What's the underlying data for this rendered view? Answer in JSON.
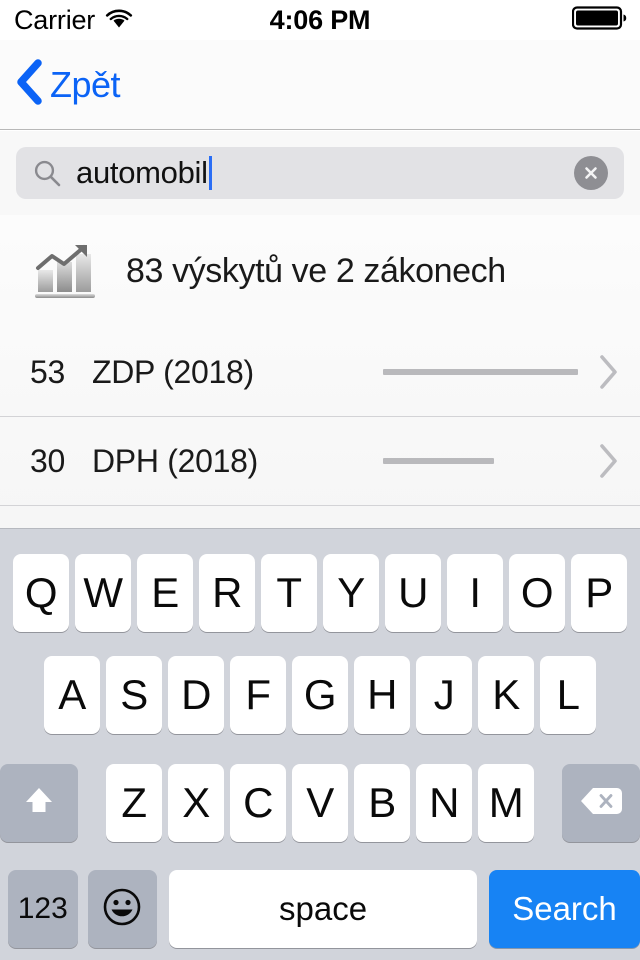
{
  "status_bar": {
    "carrier": "Carrier",
    "time": "4:06 PM",
    "wifi_icon": "wifi-icon",
    "battery_icon": "battery-full-icon"
  },
  "nav_bar": {
    "back_label": "Zpět",
    "back_icon": "chevron-left-icon"
  },
  "search": {
    "value": "automobil",
    "placeholder": "",
    "search_icon": "search-icon",
    "clear_icon": "clear-circle-icon"
  },
  "results": {
    "summary_icon": "bar-chart-trending-up-icon",
    "summary_text": "83 výskytů ve 2 zákonech",
    "total_occurrences": 83,
    "law_count": 2,
    "rows": [
      {
        "count": "53",
        "name": "ZDP (2018)",
        "bar_percent": 100,
        "chevron_icon": "chevron-right-icon"
      },
      {
        "count": "30",
        "name": "DPH (2018)",
        "bar_percent": 57,
        "chevron_icon": "chevron-right-icon"
      }
    ]
  },
  "keyboard": {
    "row1": [
      "Q",
      "W",
      "E",
      "R",
      "T",
      "Y",
      "U",
      "I",
      "O",
      "P"
    ],
    "row2": [
      "A",
      "S",
      "D",
      "F",
      "G",
      "H",
      "J",
      "K",
      "L"
    ],
    "row3": [
      "Z",
      "X",
      "C",
      "V",
      "B",
      "N",
      "M"
    ],
    "shift_icon": "shift-up-arrow-icon",
    "backspace_icon": "backspace-delete-icon",
    "numbers_label": "123",
    "emoji_icon": "smiley-face-icon",
    "space_label": "space",
    "search_label": "Search"
  },
  "colors": {
    "accent_blue": "#0b63f6",
    "key_action_blue": "#1783f4",
    "keyboard_bg": "#d1d4db",
    "key_gray": "#adb3bf",
    "search_field_bg": "#e2e2e5"
  }
}
